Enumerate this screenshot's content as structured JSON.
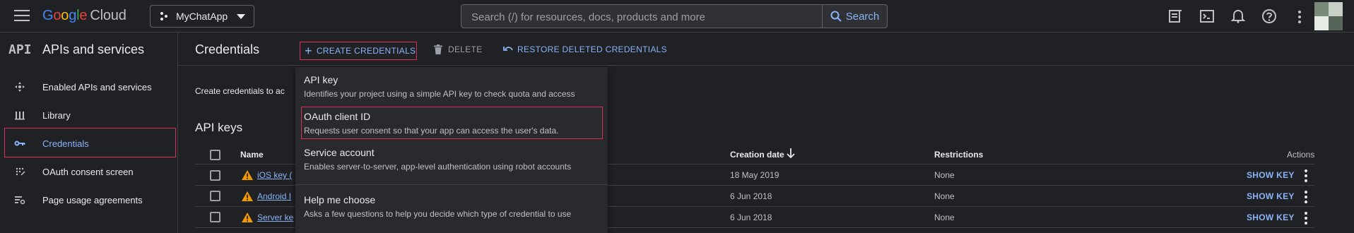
{
  "topbar": {
    "logo_google": [
      "G",
      "o",
      "o",
      "g",
      "l",
      "e"
    ],
    "logo_cloud": "Cloud",
    "project_name": "MyChatApp",
    "search_placeholder": "Search (/) for resources, docs, products and more",
    "search_button": "Search",
    "icons": [
      "notes-icon",
      "cloud-shell-icon",
      "bell-icon",
      "help-icon",
      "more-vert-icon"
    ]
  },
  "sidebar": {
    "logo": "API",
    "title": "APIs and services",
    "items": [
      {
        "label": "Enabled APIs and services",
        "icon": "move-icon"
      },
      {
        "label": "Library",
        "icon": "library-icon"
      },
      {
        "label": "Credentials",
        "icon": "key-icon",
        "active": true
      },
      {
        "label": "OAuth consent screen",
        "icon": "consent-icon"
      },
      {
        "label": "Page usage agreements",
        "icon": "agreements-icon"
      }
    ]
  },
  "main": {
    "title": "Credentials",
    "create_label": "CREATE CREDENTIALS",
    "delete_label": "DELETE",
    "restore_label": "RESTORE DELETED CREDENTIALS",
    "info_text": "Create credentials to ac",
    "section_title": "API keys",
    "columns": {
      "name": "Name",
      "creation_date": "Creation date",
      "restrictions": "Restrictions",
      "actions": "Actions"
    },
    "rows": [
      {
        "name": "iOS key (",
        "date": "18 May 2019",
        "restrictions": "None",
        "action": "SHOW KEY"
      },
      {
        "name": "Android I",
        "date": "6 Jun 2018",
        "restrictions": "None",
        "action": "SHOW KEY"
      },
      {
        "name": "Server ke",
        "date": "6 Jun 2018",
        "restrictions": "None",
        "action": "SHOW KEY"
      }
    ]
  },
  "menu": {
    "items": [
      {
        "title": "API key",
        "desc": "Identifies your project using a simple API key to check quota and access"
      },
      {
        "title": "OAuth client ID",
        "desc": "Requests user consent so that your app can access the user's data."
      },
      {
        "title": "Service account",
        "desc": "Enables server-to-server, app-level authentication using robot accounts"
      },
      {
        "title": "Help me choose",
        "desc": "Asks a few questions to help you decide which type of credential to use"
      }
    ]
  },
  "colors": {
    "accent": "#8ab4f8",
    "highlight": "#d93054",
    "warning": "#f29900"
  }
}
